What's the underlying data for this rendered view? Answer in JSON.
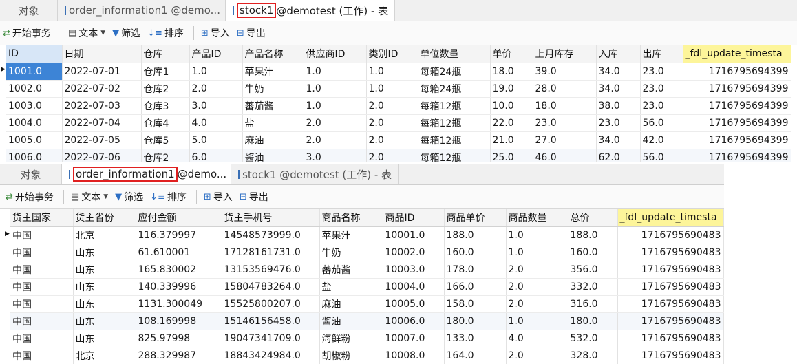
{
  "panel1": {
    "tabs": [
      {
        "label": "对象"
      },
      {
        "label": "order_information1 @demo..."
      },
      {
        "prefix": "stock1",
        "label": " @demotest (工作) - 表"
      }
    ],
    "toolbar": {
      "begin_tx": "开始事务",
      "text": "文本",
      "filter": "筛选",
      "sort": "排序",
      "import": "导入",
      "export": "导出"
    },
    "columns": [
      "ID",
      "日期",
      "仓库",
      "产品ID",
      "产品名称",
      "供应商ID",
      "类别ID",
      "单位数量",
      "单价",
      "上月库存",
      "入库",
      "出库",
      "_fdl_update_timesta"
    ],
    "rows": [
      [
        "1001.0",
        "2022-07-01",
        "仓库1",
        "1.0",
        "苹果汁",
        "1.0",
        "1.0",
        "每箱24瓶",
        "18.0",
        "39.0",
        "34.0",
        "23.0",
        "1716795694399"
      ],
      [
        "1002.0",
        "2022-07-02",
        "仓库2",
        "2.0",
        "牛奶",
        "1.0",
        "1.0",
        "每箱24瓶",
        "19.0",
        "28.0",
        "34.0",
        "23.0",
        "1716795694399"
      ],
      [
        "1003.0",
        "2022-07-03",
        "仓库3",
        "3.0",
        "蕃茄酱",
        "1.0",
        "2.0",
        "每箱12瓶",
        "10.0",
        "18.0",
        "38.0",
        "23.0",
        "1716795694399"
      ],
      [
        "1004.0",
        "2022-07-04",
        "仓库4",
        "4.0",
        "盐",
        "2.0",
        "2.0",
        "每箱12瓶",
        "22.0",
        "23.0",
        "23.0",
        "56.0",
        "1716795694399"
      ],
      [
        "1005.0",
        "2022-07-05",
        "仓库5",
        "5.0",
        "麻油",
        "2.0",
        "2.0",
        "每箱12瓶",
        "21.0",
        "27.0",
        "34.0",
        "42.0",
        "1716795694399"
      ],
      [
        "1006.0",
        "2022-07-06",
        "仓库2",
        "6.0",
        "酱油",
        "3.0",
        "2.0",
        "每箱12瓶",
        "25.0",
        "46.0",
        "62.0",
        "56.0",
        "1716795694399"
      ]
    ]
  },
  "panel2": {
    "tabs": [
      {
        "label": "对象"
      },
      {
        "prefix": "order_information1",
        "label": " @demo..."
      },
      {
        "label": "stock1 @demotest (工作) - 表"
      }
    ],
    "toolbar": {
      "begin_tx": "开始事务",
      "text": "文本",
      "filter": "筛选",
      "sort": "排序",
      "import": "导入",
      "export": "导出"
    },
    "columns": [
      "货主国家",
      "货主省份",
      "应付金额",
      "货主手机号",
      "商品名称",
      "商品ID",
      "商品单价",
      "商品数量",
      "总价",
      "_fdl_update_timesta"
    ],
    "rows": [
      [
        "中国",
        "北京",
        "116.379997",
        "14548573999.0",
        "苹果汁",
        "10001.0",
        "188.0",
        "1.0",
        "188.0",
        "1716795690483"
      ],
      [
        "中国",
        "山东",
        "61.610001",
        "17128161731.0",
        "牛奶",
        "10002.0",
        "160.0",
        "1.0",
        "160.0",
        "1716795690483"
      ],
      [
        "中国",
        "山东",
        "165.830002",
        "13153569476.0",
        "蕃茄酱",
        "10003.0",
        "178.0",
        "2.0",
        "356.0",
        "1716795690483"
      ],
      [
        "中国",
        "山东",
        "140.339996",
        "15804783264.0",
        "盐",
        "10004.0",
        "166.0",
        "2.0",
        "332.0",
        "1716795690483"
      ],
      [
        "中国",
        "山东",
        "1131.300049",
        "15525800207.0",
        "麻油",
        "10005.0",
        "158.0",
        "2.0",
        "316.0",
        "1716795690483"
      ],
      [
        "中国",
        "山东",
        "108.169998",
        "15146156458.0",
        "酱油",
        "10006.0",
        "180.0",
        "1.0",
        "180.0",
        "1716795690483"
      ],
      [
        "中国",
        "山东",
        "825.97998",
        "19047341709.0",
        "海鲜粉",
        "10007.0",
        "133.0",
        "4.0",
        "532.0",
        "1716795690483"
      ],
      [
        "中国",
        "北京",
        "288.329987",
        "18843424984.0",
        "胡椒粉",
        "10008.0",
        "164.0",
        "2.0",
        "328.0",
        "1716795690483"
      ]
    ]
  }
}
